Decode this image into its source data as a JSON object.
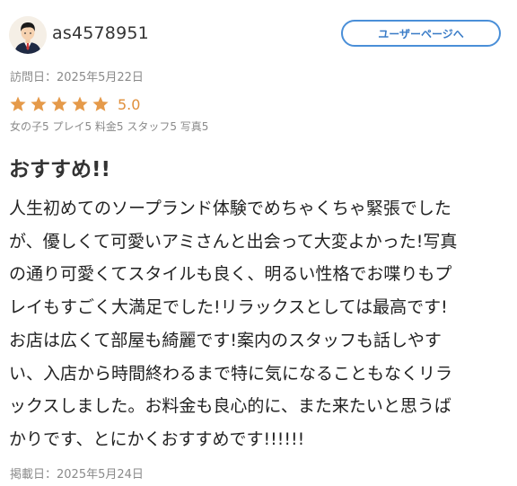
{
  "review": {
    "username": "as4578951",
    "user_page_button_label": "ユーザーページへ",
    "visit_date": "訪問日：2025年5月22日",
    "rating": {
      "stars": 5,
      "max_stars": 5,
      "value_label": "5.0",
      "star_color": "#e59a4a"
    },
    "sub_ratings": "女の子5 プレイ5 料金5 スタッフ5 写真5",
    "title": "おすすめ!!",
    "body_lines": [
      "人生初めてのソープランド体験でめちゃくちゃ緊張でした",
      "が、優しくて可愛いアミさんと出会って大変よかった!写真",
      "の通り可愛くてスタイルも良く、明るい性格でお喋りもプ",
      "レイもすごく大満足でした!リラックスとしては最高です!",
      "お店は広くて部屋も綺麗です!案内のスタッフも話しやす",
      "い、入店から時間終わるまで特に気になることもなくリラ",
      "ックスしました。お料金も良心的に、また来たいと思うば",
      "かりです、とにかくおすすめです!!!!!!"
    ],
    "posted_date": "掲載日：2025年5月24日"
  },
  "colors": {
    "accent_blue": "#4a8fd8",
    "star_orange": "#e59a4a",
    "muted_text": "#8a8a8a"
  },
  "icons": {
    "avatar": "user-avatar-icon",
    "star": "star-icon"
  }
}
